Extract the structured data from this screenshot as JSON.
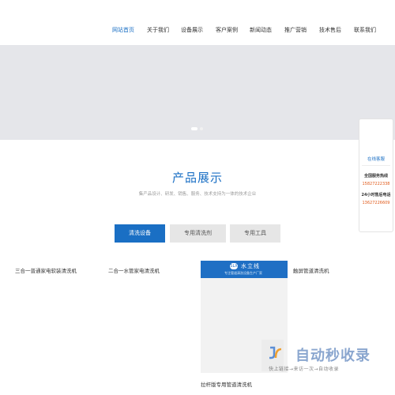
{
  "nav": {
    "items": [
      {
        "label": "网站首页",
        "active": true
      },
      {
        "label": "关于我们"
      },
      {
        "label": "设备展示"
      },
      {
        "label": "客户案例"
      },
      {
        "label": "新闻动态"
      },
      {
        "label": "推广营销"
      },
      {
        "label": "技术售后"
      },
      {
        "label": "联系我们"
      }
    ]
  },
  "banner": {
    "slides": 2,
    "current_slide": 1
  },
  "products": {
    "title": "产品展示",
    "subtitle": "集产品设计、研发、销售、服务、技术支持为一体的技术企业",
    "tabs": [
      {
        "label": "清洗设备",
        "active": true
      },
      {
        "label": "专用清洗剂"
      },
      {
        "label": "专用工具"
      }
    ],
    "items": [
      {
        "name": "三合一普通家电软装清洗机"
      },
      {
        "name": "二合一水管家电清洗机"
      },
      {
        "name": "触屏管道清洗机"
      },
      {
        "name": "拉杆版专用管道清洗机"
      }
    ],
    "card_brand": "水立线",
    "card_logo": "SLX",
    "card_sub": "专注管道清洗设备生产厂家"
  },
  "service": {
    "online": "在线客服",
    "hotline_title": "全国服务热线",
    "hotline": "15827222338",
    "aftersales_title": "24小时售后电话",
    "aftersales": "13627226609"
  },
  "watermark": {
    "title": "自动秒收录",
    "subtitle": "快上链接→来访一次→自动收录"
  },
  "colors": {
    "accent": "#1a6fc4",
    "phone": "#e05a1a",
    "banner": "#e5e6ea"
  }
}
